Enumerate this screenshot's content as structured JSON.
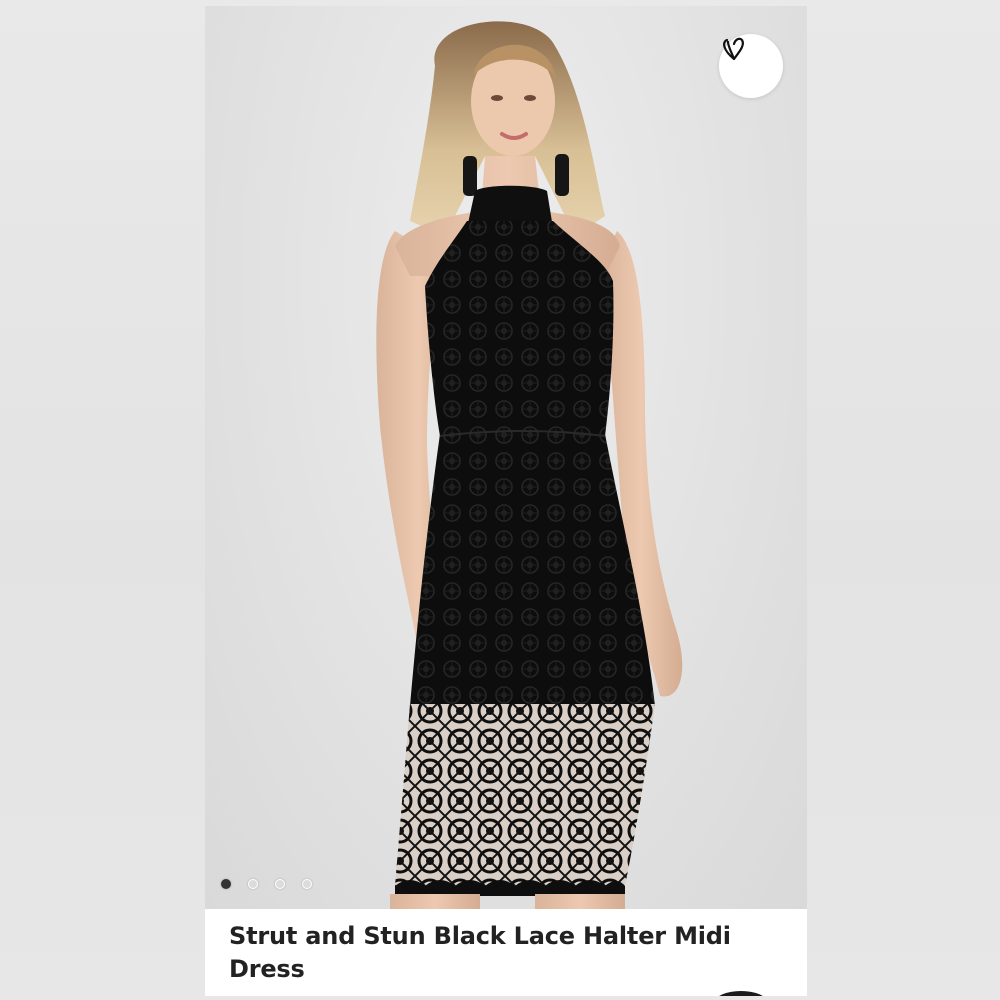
{
  "product": {
    "title": "Strut and Stun Black Lace Halter Midi Dress",
    "image_alt": "Model wearing black lace halter midi dress"
  },
  "gallery": {
    "active_index": 0,
    "slides": [
      {
        "label": "Image 1"
      },
      {
        "label": "Image 2"
      },
      {
        "label": "Image 3"
      },
      {
        "label": "Image 4"
      }
    ]
  },
  "favorite": {
    "icon": "heart-icon",
    "aria_label": "Add to favorites"
  },
  "colors": {
    "background": "#e6e6e6",
    "dress": "#111111",
    "title_text": "#222222"
  }
}
